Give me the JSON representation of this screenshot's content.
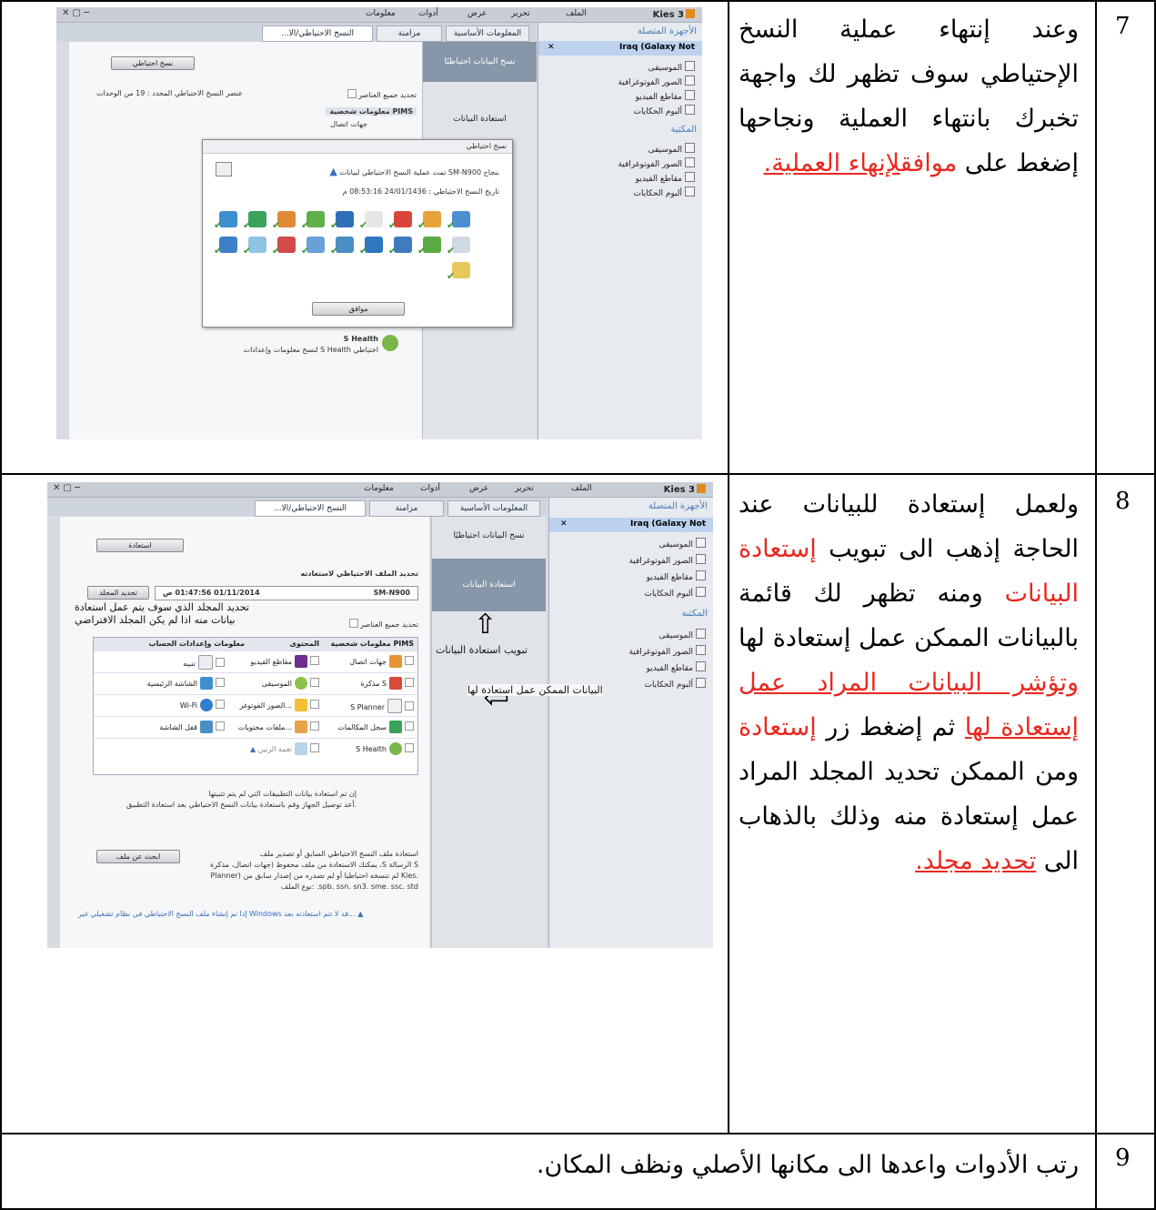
{
  "rows": [
    {
      "number": "7",
      "text_parts": [
        {
          "t": "وعند إنتهاء عملية النسخ الإحتياطي سوف تظهر لك واجهة تخبرك بانتهاء العملية ونجاحها إضغط على ",
          "style": "plain"
        },
        {
          "t": "موافق",
          "style": "red"
        },
        {
          "t": "لإنهاء العملية.",
          "style": "red-underline"
        }
      ]
    },
    {
      "number": "8",
      "text_parts": [
        {
          "t": "ولعمل إستعادة للبيانات عند الحاجة إذهب الى تبويب ",
          "style": "plain"
        },
        {
          "t": "إستعادة البيانات",
          "style": "red"
        },
        {
          "t": " ومنه تظهر لك قائمة بالبيانات الممكن عمل إستعادة لها ",
          "style": "plain"
        },
        {
          "t": "وتؤشر البيانات المراد عمل إستعادة لها",
          "style": "red-underline"
        },
        {
          "t": " ثم إضغط زر ",
          "style": "plain"
        },
        {
          "t": "إستعادة",
          "style": "red"
        },
        {
          "t": " ومن الممكن تحديد المجلد المراد عمل إستعادة منه وذلك بالذهاب الى ",
          "style": "plain"
        },
        {
          "t": "تحديد مجلد.",
          "style": "red-underline"
        }
      ]
    },
    {
      "number": "9",
      "text": "رتب الأدوات واعدها الى مكانها الأصلي ونظف المكان."
    }
  ],
  "screenshot1": {
    "app": "Kies 3",
    "menu": [
      "الملف",
      "تحرير",
      "عرض",
      "أدوات",
      "معلومات"
    ],
    "tabs": [
      "المعلومات الأساسية",
      "مزامنة",
      "...النسخ الاحتياطي/الا"
    ],
    "sidebar": {
      "connected_header": "الأجهزة المتصلة",
      "device": "Iraq (Galaxy Not",
      "device_items": [
        "الموسيقى",
        "الصور الفوتوغرافية",
        "مقاطع الفيديو",
        "ألبوم الحكايات"
      ],
      "library_header": "المكتبة",
      "library_items": [
        "الموسيقى",
        "الصور الفوتوغرافية",
        "مقاطع الفيديو",
        "ألبوم الحكايات"
      ]
    },
    "nav": [
      "نسخ البيانات احتياطيًا",
      "استعادة البيانات"
    ],
    "backup_button": "نسخ احتياطي",
    "select_all": "تحديد جميع العناصر",
    "count_text": "عنصر النسخ الاحتياطي المحدد : 19 من الوحدات",
    "pims": "PIMS معلومات شخصية",
    "contacts": "جهات اتصال",
    "shealth_title": "S Health",
    "shealth_desc": "اختياطي S Health لنسخ معلومات وإعدادات",
    "dialog": {
      "title": "نسخ احتياطي",
      "message": "بنجاح SM-N900 تمت عملية النسخ الاحتياطي لبيانات",
      "date_label": "تاريخ النسخ الاحتياطي : 24/01/1436 08:53:16 م",
      "ok": "موافق"
    }
  },
  "screenshot2": {
    "app": "Kies 3",
    "menu": [
      "الملف",
      "تحرير",
      "عرض",
      "أدوات",
      "معلومات"
    ],
    "tabs": [
      "المعلومات الأساسية",
      "مزامنة",
      "...النسخ الاحتياطي/الا"
    ],
    "sidebar": {
      "connected_header": "الأجهزة المتصلة",
      "device": "Iraq (Galaxy Not",
      "device_items": [
        "الموسيقى",
        "الصور الفوتوغرافية",
        "مقاطع الفيديو",
        "ألبوم الحكايات"
      ],
      "library_header": "المكتبة",
      "library_items": [
        "الموسيقى",
        "الصور الفوتوغرافية",
        "مقاطع الفيديو",
        "ألبوم الحكايات"
      ]
    },
    "nav": [
      "نسخ البيانات احتياطيًا",
      "استعادة البيانات"
    ],
    "restore_button": "استعادة",
    "select_file_label": "تحديد الملف الاحتياطي لاستعادته",
    "device_model": "SM-N900",
    "backup_date": "01/11/2014 01:47:56 ص",
    "select_folder": "تحديد المجلد",
    "folder_note_1": "تحديد المجلد الذي سوف يتم عمل استعادة",
    "folder_note_2": "بيانات منه اذا لم يكن المجلد الافتراضي",
    "select_all": "تحديد جميع العناصر",
    "columns": [
      "PIMS معلومات شخصية",
      "المحتوى",
      "معلومات وإعدادات الحساب"
    ],
    "grid": [
      [
        "جهات اتصال",
        "مقاطع الفيديو",
        "تنبيه"
      ],
      [
        "S مذكرة",
        "الموسيقى",
        "الشاشة الرئيسية"
      ],
      [
        "S Planner",
        "...الصور الفوتوغر",
        "Wi-Fi"
      ],
      [
        "سجل المكالمات",
        "...ملفات محتويات",
        "قفل الشاشة"
      ],
      [
        "S Health",
        "نغمة الرنين",
        ""
      ]
    ],
    "note_1": "إن تم استعادة بيانات التطبيقات التي لم يتم تثبيتها",
    "note_2": ".أعد توصيل الجهاز وقم باستعادة بيانات النسخ الاحتياطي بعد استعادة التطبيق",
    "find_file": "ابحث عن ملف",
    "restore_file_1": "استعادة ملف النسخ الاحتياطي السابق أو تصدير ملف",
    "restore_file_2": "S الرسالة S، يمكنك الاستعادة من ملف محفوظ (جهات اتصال، مذكرة",
    "restore_file_3": ".Kies لم تنسخه احتياطيا أو لم تصدره من إصدار سابق من (Planner",
    "restore_file_4": "spb. ssn. sn3. sme. ssc. std. :نوع الملف",
    "warning": "...قد لا تتم استعادته بعد Windows إذا تم إنشاء ملف النسخ الاحتياطي في نظام تشغيلي غير",
    "annot_tab": "تبويب استعادة البيانات",
    "annot_list": "البيانات الممكن عمل استعادة لها"
  }
}
